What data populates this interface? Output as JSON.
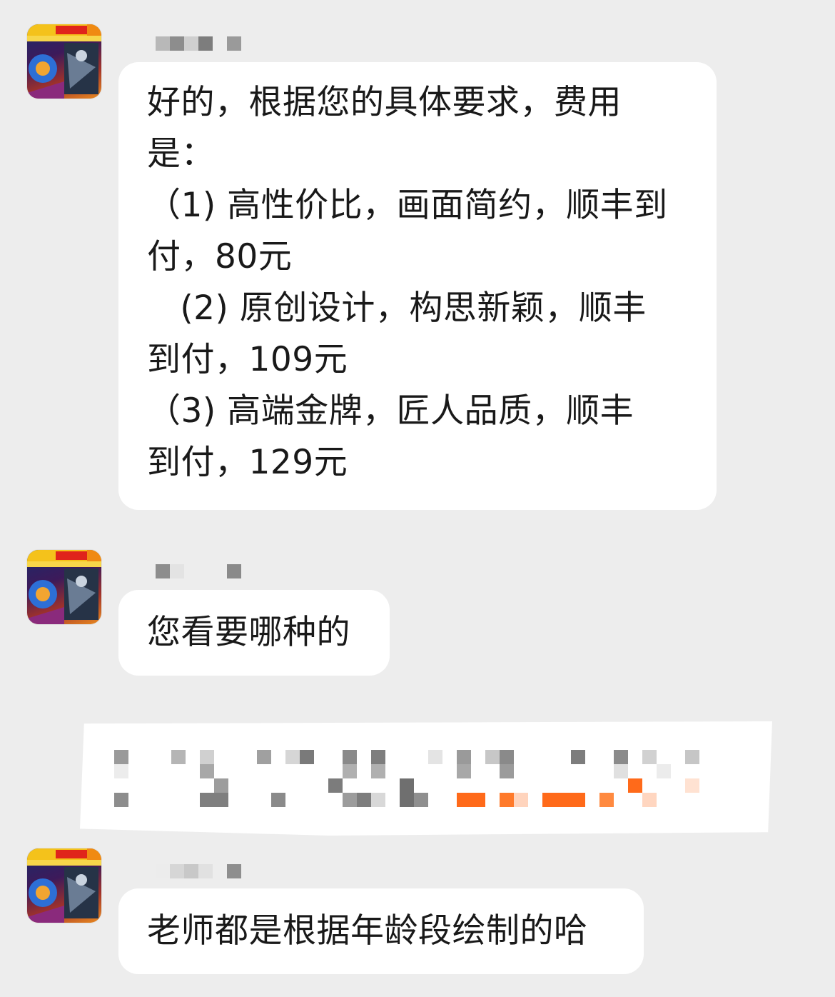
{
  "chat": {
    "messages": [
      {
        "lines": [
          "好的，根据您的具体要求，费用",
          "是：",
          "（1) 高性价比，画面简约，顺丰到",
          "付，80元",
          "   (2) 原创设计，构思新颖，顺丰",
          "到付，109元",
          "（3) 高端金牌，匠人品质，顺丰",
          "到付，129元"
        ]
      },
      {
        "lines": [
          "您看要哪种的"
        ]
      },
      {
        "lines": [
          "老师都是根据年龄段绘制的哈"
        ]
      }
    ],
    "avatar_icon": "shop-avatar-icon",
    "colors": {
      "background": "#ededed",
      "bubble": "#ffffff",
      "text": "#191919",
      "redaction_gray": "#8a8a8a",
      "redaction_orange": "#ff6a1a"
    }
  }
}
